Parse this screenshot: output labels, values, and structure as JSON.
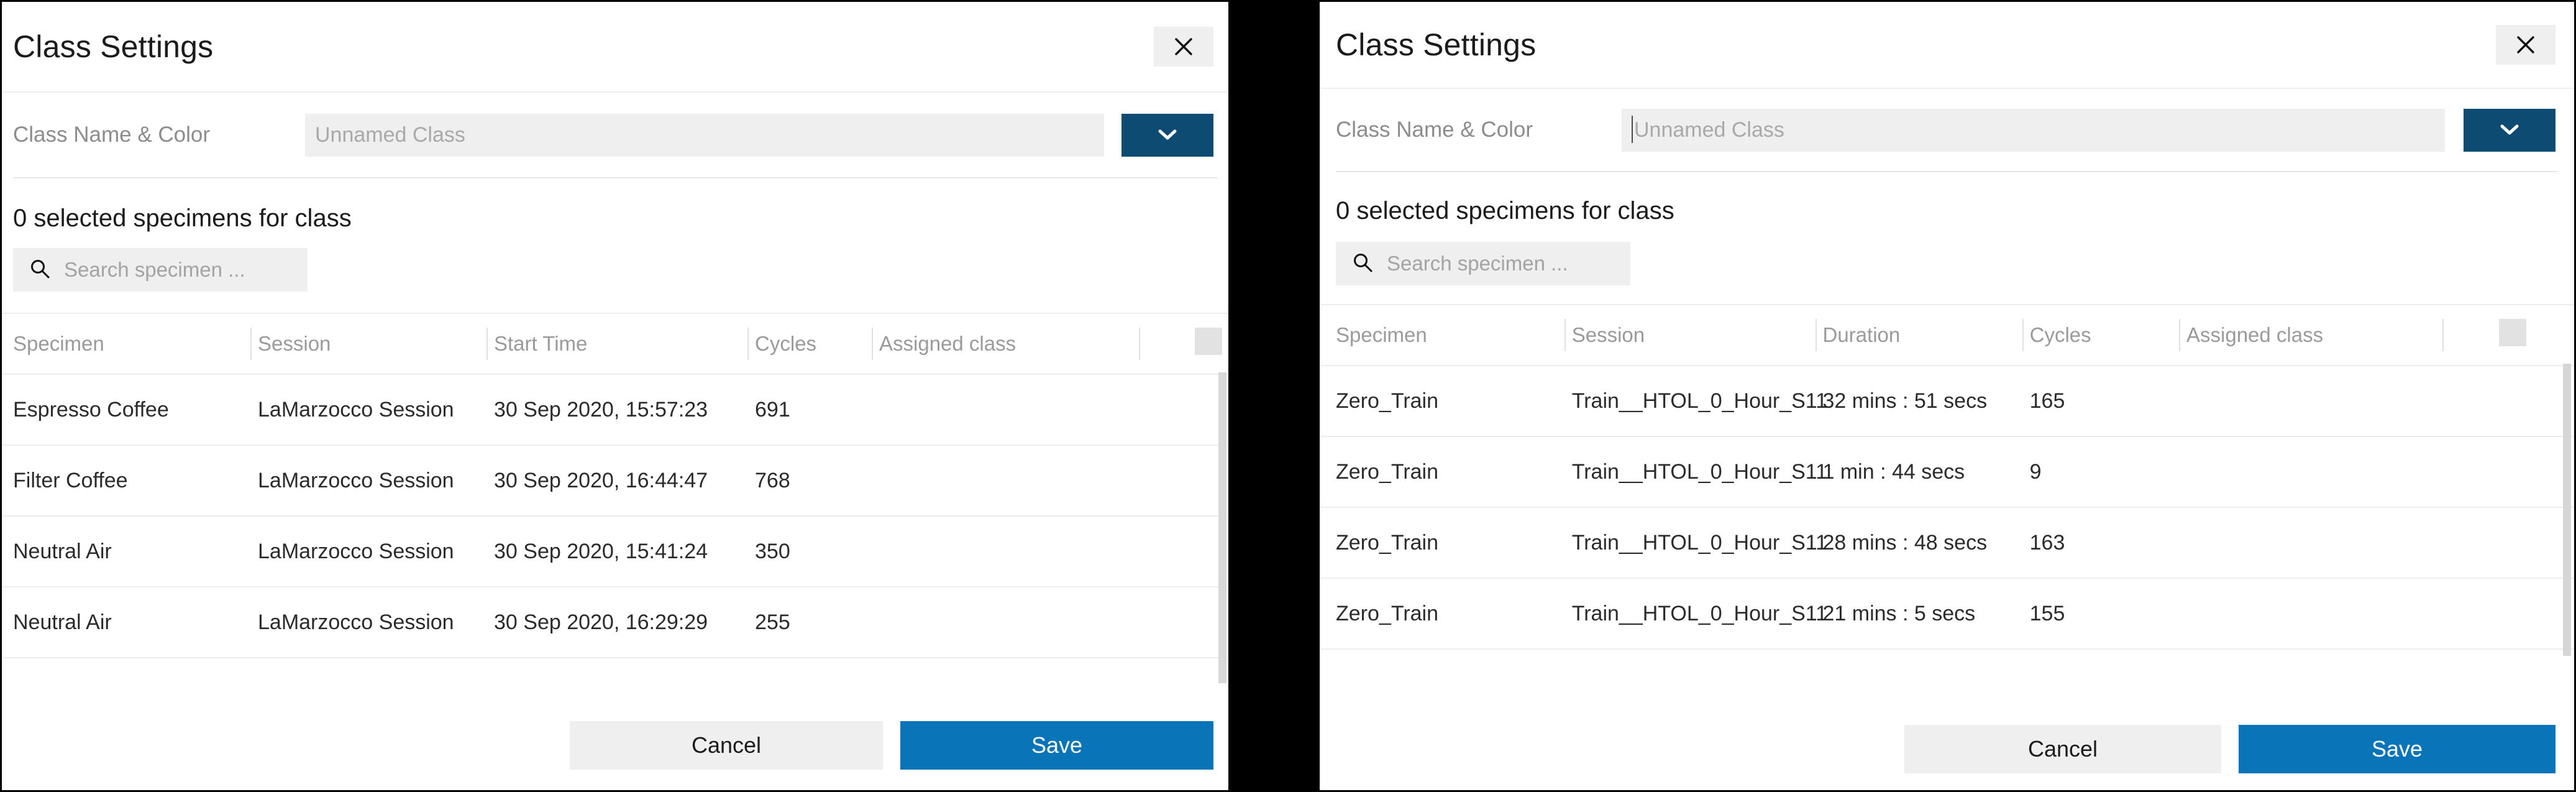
{
  "left_dialog": {
    "title": "Class Settings",
    "close_icon": "close-icon",
    "form": {
      "label": "Class Name & Color",
      "name_placeholder": "Unnamed Class",
      "name_value": "",
      "color_swatch_hex": "#0d4b73",
      "chevron_icon": "chevron-down-icon"
    },
    "selection_summary": "0 selected specimens for class",
    "search": {
      "placeholder": "Search specimen ...",
      "value": "",
      "icon": "search-icon"
    },
    "table": {
      "columns": [
        "Specimen",
        "Session",
        "Start Time",
        "Cycles",
        "Assigned class",
        "",
        ""
      ],
      "rows": [
        {
          "specimen": "Espresso Coffee",
          "session": "LaMarzocco Session",
          "start_time": "30 Sep 2020, 15:57:23",
          "cycles": "691",
          "assigned_class": ""
        },
        {
          "specimen": "Filter Coffee",
          "session": "LaMarzocco Session",
          "start_time": "30 Sep 2020, 16:44:47",
          "cycles": "768",
          "assigned_class": ""
        },
        {
          "specimen": "Neutral Air",
          "session": "LaMarzocco Session",
          "start_time": "30 Sep 2020, 15:41:24",
          "cycles": "350",
          "assigned_class": ""
        },
        {
          "specimen": "Neutral Air",
          "session": "LaMarzocco Session",
          "start_time": "30 Sep 2020, 16:29:29",
          "cycles": "255",
          "assigned_class": ""
        }
      ]
    },
    "footer": {
      "cancel_label": "Cancel",
      "save_label": "Save"
    }
  },
  "right_dialog": {
    "title": "Class Settings",
    "close_icon": "close-icon",
    "form": {
      "label": "Class Name & Color",
      "name_placeholder": "Unnamed Class",
      "name_value": "",
      "color_swatch_hex": "#0d4b73",
      "chevron_icon": "chevron-down-icon"
    },
    "selection_summary": "0 selected specimens for class",
    "search": {
      "placeholder": "Search specimen ...",
      "value": "",
      "icon": "search-icon"
    },
    "table": {
      "columns": [
        "Specimen",
        "Session",
        "Duration",
        "Cycles",
        "Assigned class",
        "",
        ""
      ],
      "rows": [
        {
          "specimen": "Zero_Train",
          "session": "Train__HTOL_0_Hour_S11",
          "duration": "32 mins : 51 secs",
          "cycles": "165",
          "assigned_class": ""
        },
        {
          "specimen": "Zero_Train",
          "session": "Train__HTOL_0_Hour_S11",
          "duration": "1 min : 44 secs",
          "cycles": "9",
          "assigned_class": ""
        },
        {
          "specimen": "Zero_Train",
          "session": "Train__HTOL_0_Hour_S11",
          "duration": "28 mins : 48 secs",
          "cycles": "163",
          "assigned_class": ""
        },
        {
          "specimen": "Zero_Train",
          "session": "Train__HTOL_0_Hour_S11",
          "duration": "21 mins : 5 secs",
          "cycles": "155",
          "assigned_class": ""
        }
      ]
    },
    "footer": {
      "cancel_label": "Cancel",
      "save_label": "Save"
    }
  },
  "theme": {
    "save_button_hex": "#0a74b9",
    "color_swatch_hex": "#0d4b73",
    "field_bg_hex": "#efefef",
    "border_hex": "#ededed",
    "text_hex": "#1b1b1b",
    "muted_text_hex": "#9a9a9a",
    "backdrop_hex": "#000000"
  }
}
